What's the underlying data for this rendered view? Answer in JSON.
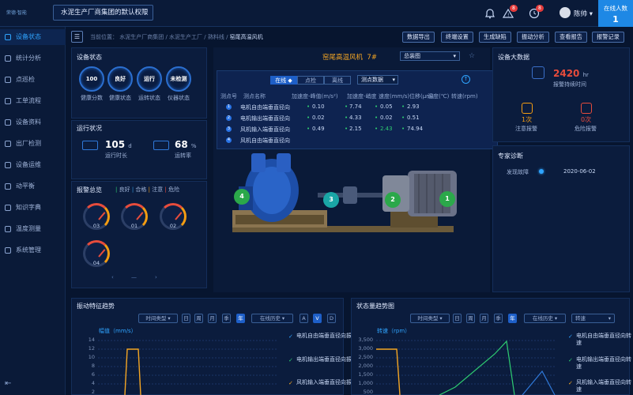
{
  "topbar": {
    "logo_text": "荣德·智能",
    "org_select": "水泥生产厂商集团的默认权限",
    "alerts_count": "8",
    "clock_count": "8",
    "username": "陈帅",
    "online_label": "在线人数",
    "online_count": "1"
  },
  "sidebar": {
    "items": [
      {
        "label": "设备状态",
        "icon": "grid-icon",
        "active": true
      },
      {
        "label": "统计分析",
        "icon": "chart-icon"
      },
      {
        "label": "点巡检",
        "icon": "location-icon"
      },
      {
        "label": "工单流程",
        "icon": "flow-icon"
      },
      {
        "label": "设备资料",
        "icon": "doc-icon"
      },
      {
        "label": "出厂检测",
        "icon": "factory-icon"
      },
      {
        "label": "设备运维",
        "icon": "wrench-icon"
      },
      {
        "label": "动平衡",
        "icon": "balance-icon"
      },
      {
        "label": "知识字典",
        "icon": "book-icon"
      },
      {
        "label": "温度测量",
        "icon": "thermo-icon"
      },
      {
        "label": "系统管理",
        "icon": "gear-icon"
      }
    ]
  },
  "breadcrumb": {
    "prefix": "当前位置：",
    "items": [
      "水泥生产厂商集团",
      "水泥生产工厂",
      "熟料线",
      "窑尾高温风机"
    ]
  },
  "actions": [
    "数据导出",
    "终端设置",
    "生成缺陷",
    "振动分析",
    "查看报告",
    "报警记录"
  ],
  "device_status": {
    "title": "设备状态",
    "gauges": [
      {
        "value": "100",
        "label": "健康分数"
      },
      {
        "value": "良好",
        "label": "健康状态"
      },
      {
        "value": "运行",
        "label": "运转状态"
      },
      {
        "value": "未检测",
        "label": "仪器状态"
      }
    ]
  },
  "run_status": {
    "title": "运行状况",
    "run_time": "105",
    "run_time_unit": "d",
    "run_time_label": "运行时长",
    "run_rate": "68",
    "run_rate_unit": "%",
    "run_rate_label": "运转率"
  },
  "alarm_overview": {
    "title": "报警总览",
    "legend": [
      "良好",
      "合格",
      "注意",
      "危险"
    ],
    "dials": [
      "03",
      "01",
      "02",
      "04"
    ]
  },
  "machine": {
    "name": "窑尾高温风机",
    "number": "7#",
    "view_select": "总装图",
    "tabs": [
      "在线",
      "点检",
      "离线"
    ],
    "data_select": "测点数据",
    "table_headers": [
      "测点号",
      "测点名称",
      "加速度-峰值(m/s²)",
      "加速度-峭度",
      "速度(mm/s)",
      "位移(μm)",
      "温度(℃)",
      "转速(rpm)"
    ],
    "rows": [
      {
        "no": "1",
        "name": "电机自由端垂直径向",
        "v1": "0.10",
        "v2": "7.74",
        "v3": "0.05",
        "v4": "2.93"
      },
      {
        "no": "2",
        "name": "电机输出端垂直径向",
        "v1": "0.02",
        "v2": "4.33",
        "v3": "0.02",
        "v4": "0.51"
      },
      {
        "no": "3",
        "name": "风机输入端垂直径向",
        "v1": "0.49",
        "v2": "2.15",
        "v3": "2.43",
        "v4": "74.94"
      },
      {
        "no": "4",
        "name": "风机自由端垂直径向",
        "v1": "",
        "v2": "",
        "v3": "",
        "v4": ""
      }
    ],
    "markers": [
      "4",
      "3",
      "2",
      "1"
    ]
  },
  "big_data": {
    "title": "设备大数据",
    "hours": "2420",
    "hours_unit": "hr",
    "hours_label": "报警持续时间",
    "notice": "1次",
    "notice_label": "注意报警",
    "danger": "0次",
    "danger_label": "危险报警"
  },
  "expert": {
    "title": "专家诊断",
    "fault": "发现故障",
    "date": "2020-06-02"
  },
  "vib_trend": {
    "title": "振动特征趋势",
    "time_type": "时间类型",
    "periods": [
      "日",
      "周",
      "月",
      "季",
      "年"
    ],
    "history": "在线历史",
    "modes": [
      "A",
      "V",
      "D"
    ],
    "ylabel": "幅值（mm/s）",
    "yticks": [
      "14",
      "12",
      "10",
      "8",
      "6",
      "4",
      "2"
    ],
    "legend": [
      "电机自由端垂直径向振动",
      "电机输出端垂直径向振动",
      "风机输入端垂直径向振动"
    ]
  },
  "state_trend": {
    "title": "状态量趋势图",
    "time_type": "时间类型",
    "periods": [
      "日",
      "周",
      "月",
      "季",
      "年"
    ],
    "history": "在线历史",
    "measure": "转速",
    "ylabel": "转速（rpm）",
    "yticks": [
      "3,500",
      "3,000",
      "2,500",
      "2,000",
      "1,500",
      "1,000",
      "500"
    ],
    "legend": [
      "电机自由端垂直径向转速",
      "电机输出端垂直径向转速",
      "风机输入端垂直径向转速"
    ]
  }
}
